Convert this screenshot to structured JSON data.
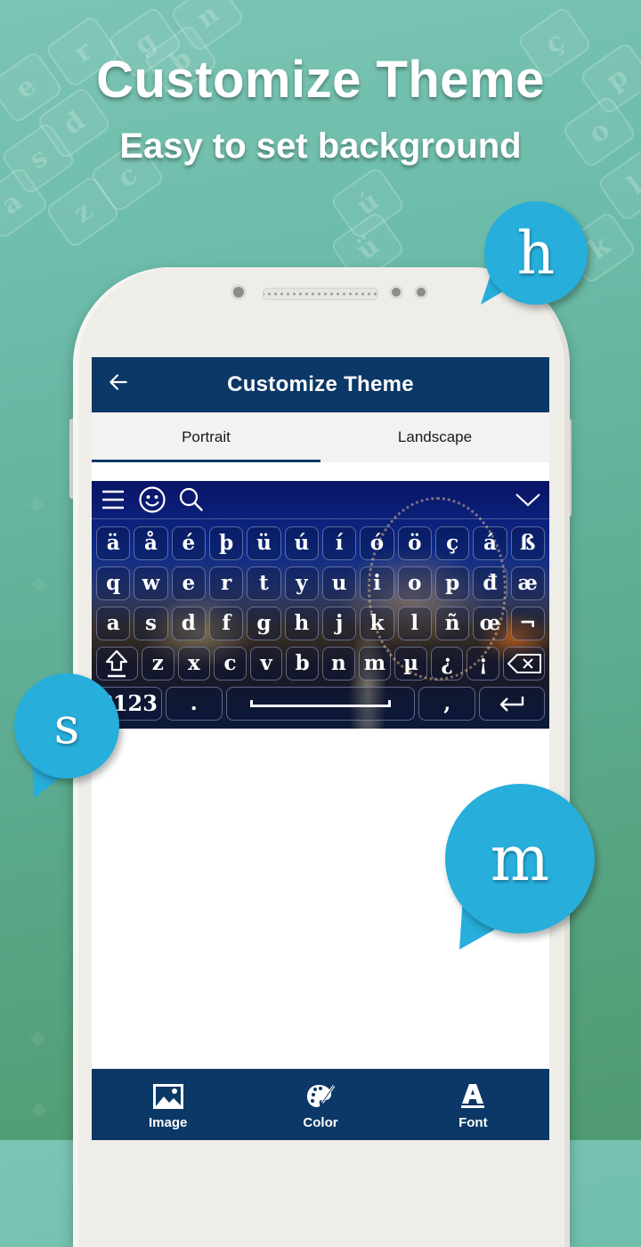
{
  "hero": {
    "title": "Customize Theme",
    "subtitle": "Easy to set background"
  },
  "background_pattern_keys": [
    "r",
    "e",
    "g",
    "b",
    "n",
    "d",
    "s",
    "c",
    "z",
    "a",
    "ç",
    "p",
    "o",
    "l",
    "k",
    "ú",
    "ü"
  ],
  "app": {
    "title": "Customize Theme",
    "back_icon": "arrow-left-icon",
    "tabs": [
      {
        "label": "Portrait",
        "active": true
      },
      {
        "label": "Landscape",
        "active": false
      }
    ],
    "accent_color": "#0b3866"
  },
  "keyboard_preview": {
    "toolbar_icons": [
      "menu-icon",
      "emoji-icon",
      "search-icon",
      "chevron-down-icon"
    ],
    "rows": [
      [
        "ä",
        "å",
        "é",
        "þ",
        "ü",
        "ú",
        "í",
        "ó",
        "ö",
        "ç",
        "á",
        "ß"
      ],
      [
        "q",
        "w",
        "e",
        "r",
        "t",
        "y",
        "u",
        "i",
        "o",
        "p",
        "đ",
        "æ"
      ],
      [
        "a",
        "s",
        "d",
        "f",
        "g",
        "h",
        "j",
        "k",
        "l",
        "ñ",
        "œ",
        "¬"
      ],
      [
        "z",
        "x",
        "c",
        "v",
        "b",
        "n",
        "m",
        "µ",
        "¿",
        "¡"
      ]
    ],
    "bottom_row": {
      "numbers_label": "?123",
      "period_label": ".",
      "comma_label": ","
    },
    "shift_icon": "shift-icon",
    "backspace_icon": "backspace-icon",
    "enter_icon": "enter-icon"
  },
  "bottom_nav": [
    {
      "label": "Image",
      "icon": "image-icon"
    },
    {
      "label": "Color",
      "icon": "palette-icon"
    },
    {
      "label": "Font",
      "icon": "font-icon"
    }
  ],
  "bubbles": [
    {
      "letter": "h"
    },
    {
      "letter": "s"
    },
    {
      "letter": "m"
    }
  ],
  "bubble_color": "#27aedb"
}
